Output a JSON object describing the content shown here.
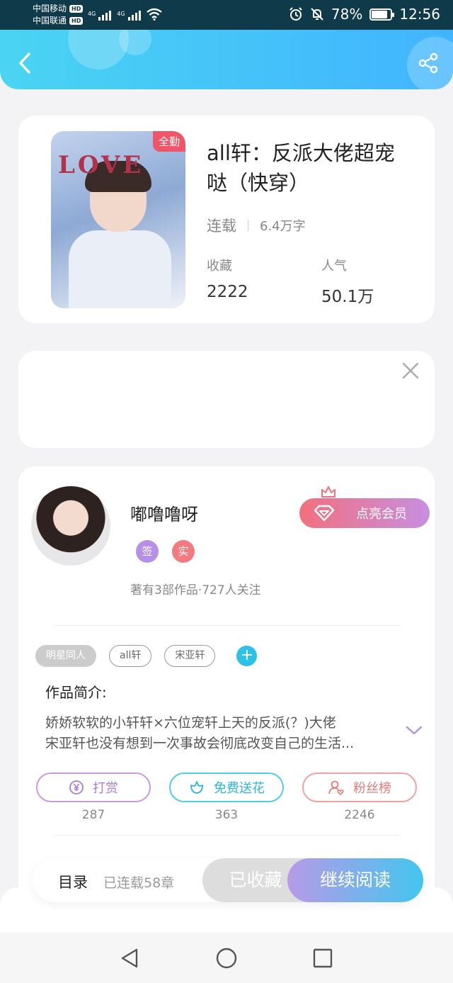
{
  "status_bar": {
    "carrier_1": "中国移动",
    "carrier_2": "中国联通",
    "hd_badge": "HD",
    "network": "4G",
    "battery": "78%",
    "time": "12:56"
  },
  "book": {
    "cover_badge": "全勤",
    "cover_text": "LOVE",
    "title": "all轩：反派大佬超宠哒（快穿）",
    "status": "连载",
    "word_count": "6.4万字",
    "favorites_label": "收藏",
    "favorites_value": "2222",
    "popularity_label": "人气",
    "popularity_value": "50.1万"
  },
  "author": {
    "name": "嘟噜噜呀",
    "sign_badge": "签",
    "real_badge": "实",
    "stats": "著有3部作品·727人关注",
    "vip_button": "点亮会员"
  },
  "tags": [
    "明星同人",
    "all轩",
    "宋亚轩"
  ],
  "add_tag_label": "+",
  "intro": {
    "heading": "作品简介:",
    "line1": "娇娇软软的小轩轩×六位宠轩上天的反派(？)大佬",
    "line2": "宋亚轩也没有想到一次事故会彻底改变自己的生活..."
  },
  "actions": [
    {
      "label": "打赏",
      "count": "287"
    },
    {
      "label": "免费送花",
      "count": "363"
    },
    {
      "label": "粉丝榜",
      "count": "2246"
    }
  ],
  "bottom_bar": {
    "toc_label": "目录",
    "toc_progress": "已连载58章",
    "collected_label": "已收藏",
    "continue_label": "继续阅读"
  },
  "colors": {
    "header_start": "#4ad4f2",
    "header_end": "#41b4ff",
    "vip_start": "#f2707e",
    "vip_end": "#c78fe0",
    "continue_end": "#43c6ee"
  }
}
